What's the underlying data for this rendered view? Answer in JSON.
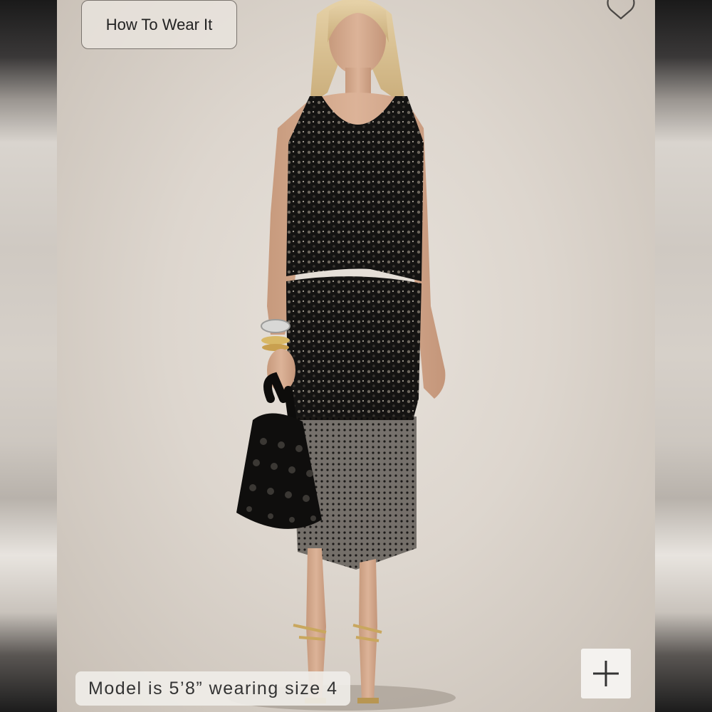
{
  "overlay": {
    "how_to_wear_label": "How To Wear It",
    "model_caption": "Model is 5’8” wearing size 4",
    "wishlist_icon": "heart-outline-icon",
    "zoom_icon": "plus-icon"
  },
  "colors": {
    "backdrop": "#ddd6ce",
    "sequin_black": "#111111",
    "button_border": "#7a746e"
  }
}
